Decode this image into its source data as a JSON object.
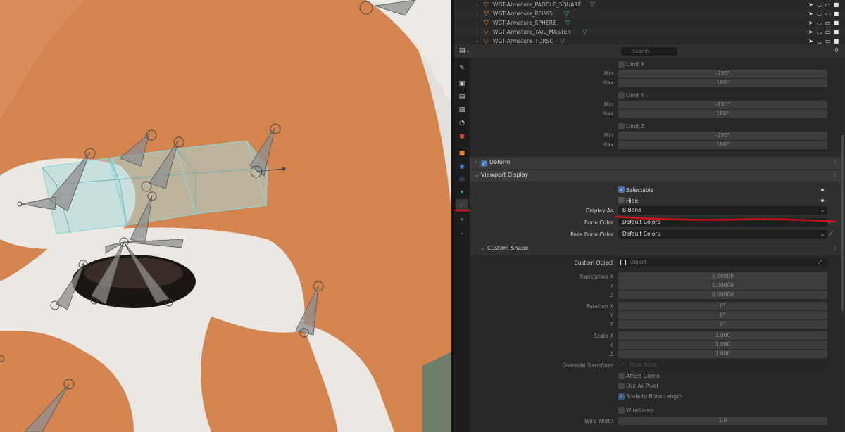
{
  "outliner": {
    "rows": [
      {
        "name": "WGT-Armature_PADDLE_SQUARE"
      },
      {
        "name": "WGT-Armature_PELVIS"
      },
      {
        "name": "WGT-Armature_SPHERE"
      },
      {
        "name": "WGT-Armature_TAIL_MASTER"
      },
      {
        "name": "WGT-Armature_TORSO"
      }
    ]
  },
  "header": {
    "search_placeholder": "Search"
  },
  "transform_limits": {
    "limit_x": "Limit X",
    "limit_y": "Limit Y",
    "limit_z": "Limit Z",
    "min_label": "Min",
    "max_label": "Max",
    "min_value": "-180°",
    "max_value": "180°"
  },
  "deform": {
    "label": "Deform"
  },
  "viewport_display": {
    "title": "Viewport Display",
    "selectable": "Selectable",
    "hide": "Hide",
    "display_as_label": "Display As",
    "display_as_value": "B-Bone",
    "bone_color_label": "Bone Color",
    "bone_color_value": "Default Colors",
    "pose_bone_color_label": "Pose Bone Color",
    "pose_bone_color_value": "Default Colors"
  },
  "custom_shape": {
    "title": "Custom Shape",
    "custom_object_label": "Custom Object",
    "custom_object_placeholder": "Object",
    "translation_label": "Translation X",
    "rotation_label": "Rotation X",
    "scale_label": "Scale X",
    "y_label": "Y",
    "z_label": "Z",
    "translation_values": [
      "0.00000",
      "0.00000",
      "0.00000"
    ],
    "rotation_values": [
      "0°",
      "0°",
      "0°"
    ],
    "scale_values": [
      "1.000",
      "1.000",
      "1.000"
    ],
    "override_transform_label": "Override Transform",
    "override_transform_placeholder": "Pose Bone",
    "affect_gizmo": "Affect Gizmo",
    "use_as_pivot": "Use As Pivot",
    "scale_to_bone_length": "Scale to Bone Length",
    "wireframe": "Wireframe",
    "wire_width_label": "Wire Width",
    "wire_width_value": "1.0"
  },
  "colors": {
    "accent_blue": "#4772b3",
    "annotation_red": "#d4101a",
    "fur_orange": "#d98a55",
    "bone_cyan": "#8fd6d6"
  }
}
